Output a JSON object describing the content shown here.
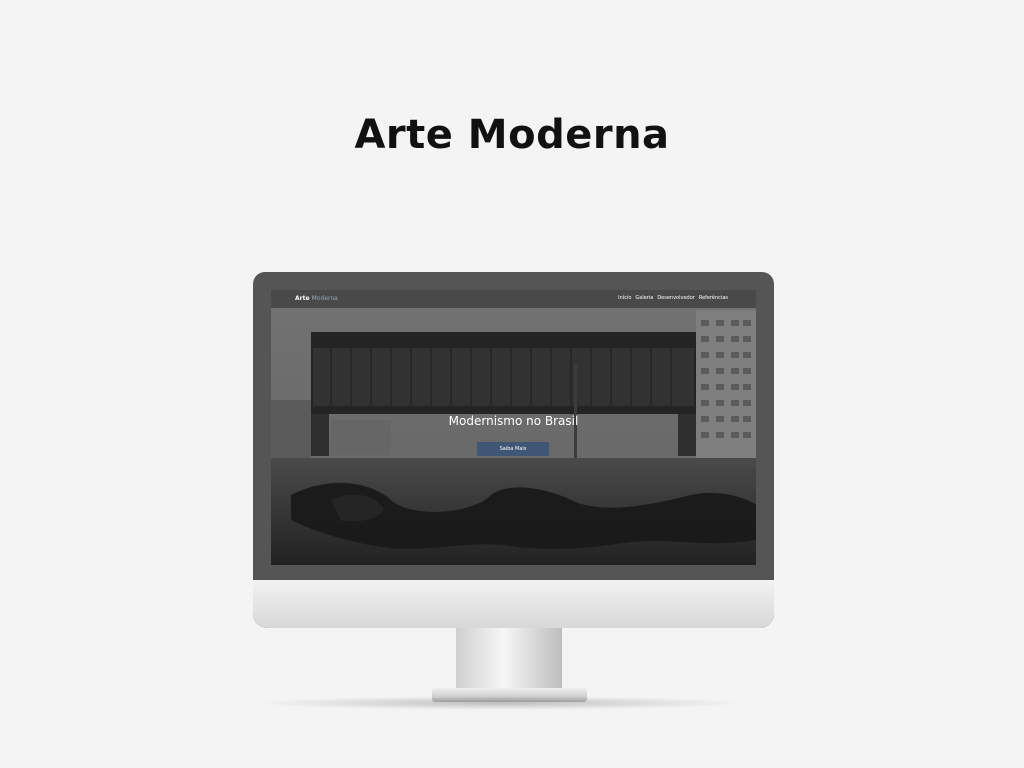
{
  "page": {
    "title": "Arte Moderna"
  },
  "site": {
    "logo": {
      "main": "Arte",
      "accent": "Moderna"
    },
    "nav": [
      {
        "label": "Início"
      },
      {
        "label": "Galeria"
      },
      {
        "label": "Desenvolvedor"
      },
      {
        "label": "Referências"
      }
    ],
    "hero": {
      "title": "Modernismo no Brasil",
      "button_label": "Saiba Mais",
      "image": "modern-architecture-photo"
    }
  },
  "colors": {
    "background": "#f4f4f4",
    "accent_button": "#3f5675"
  }
}
